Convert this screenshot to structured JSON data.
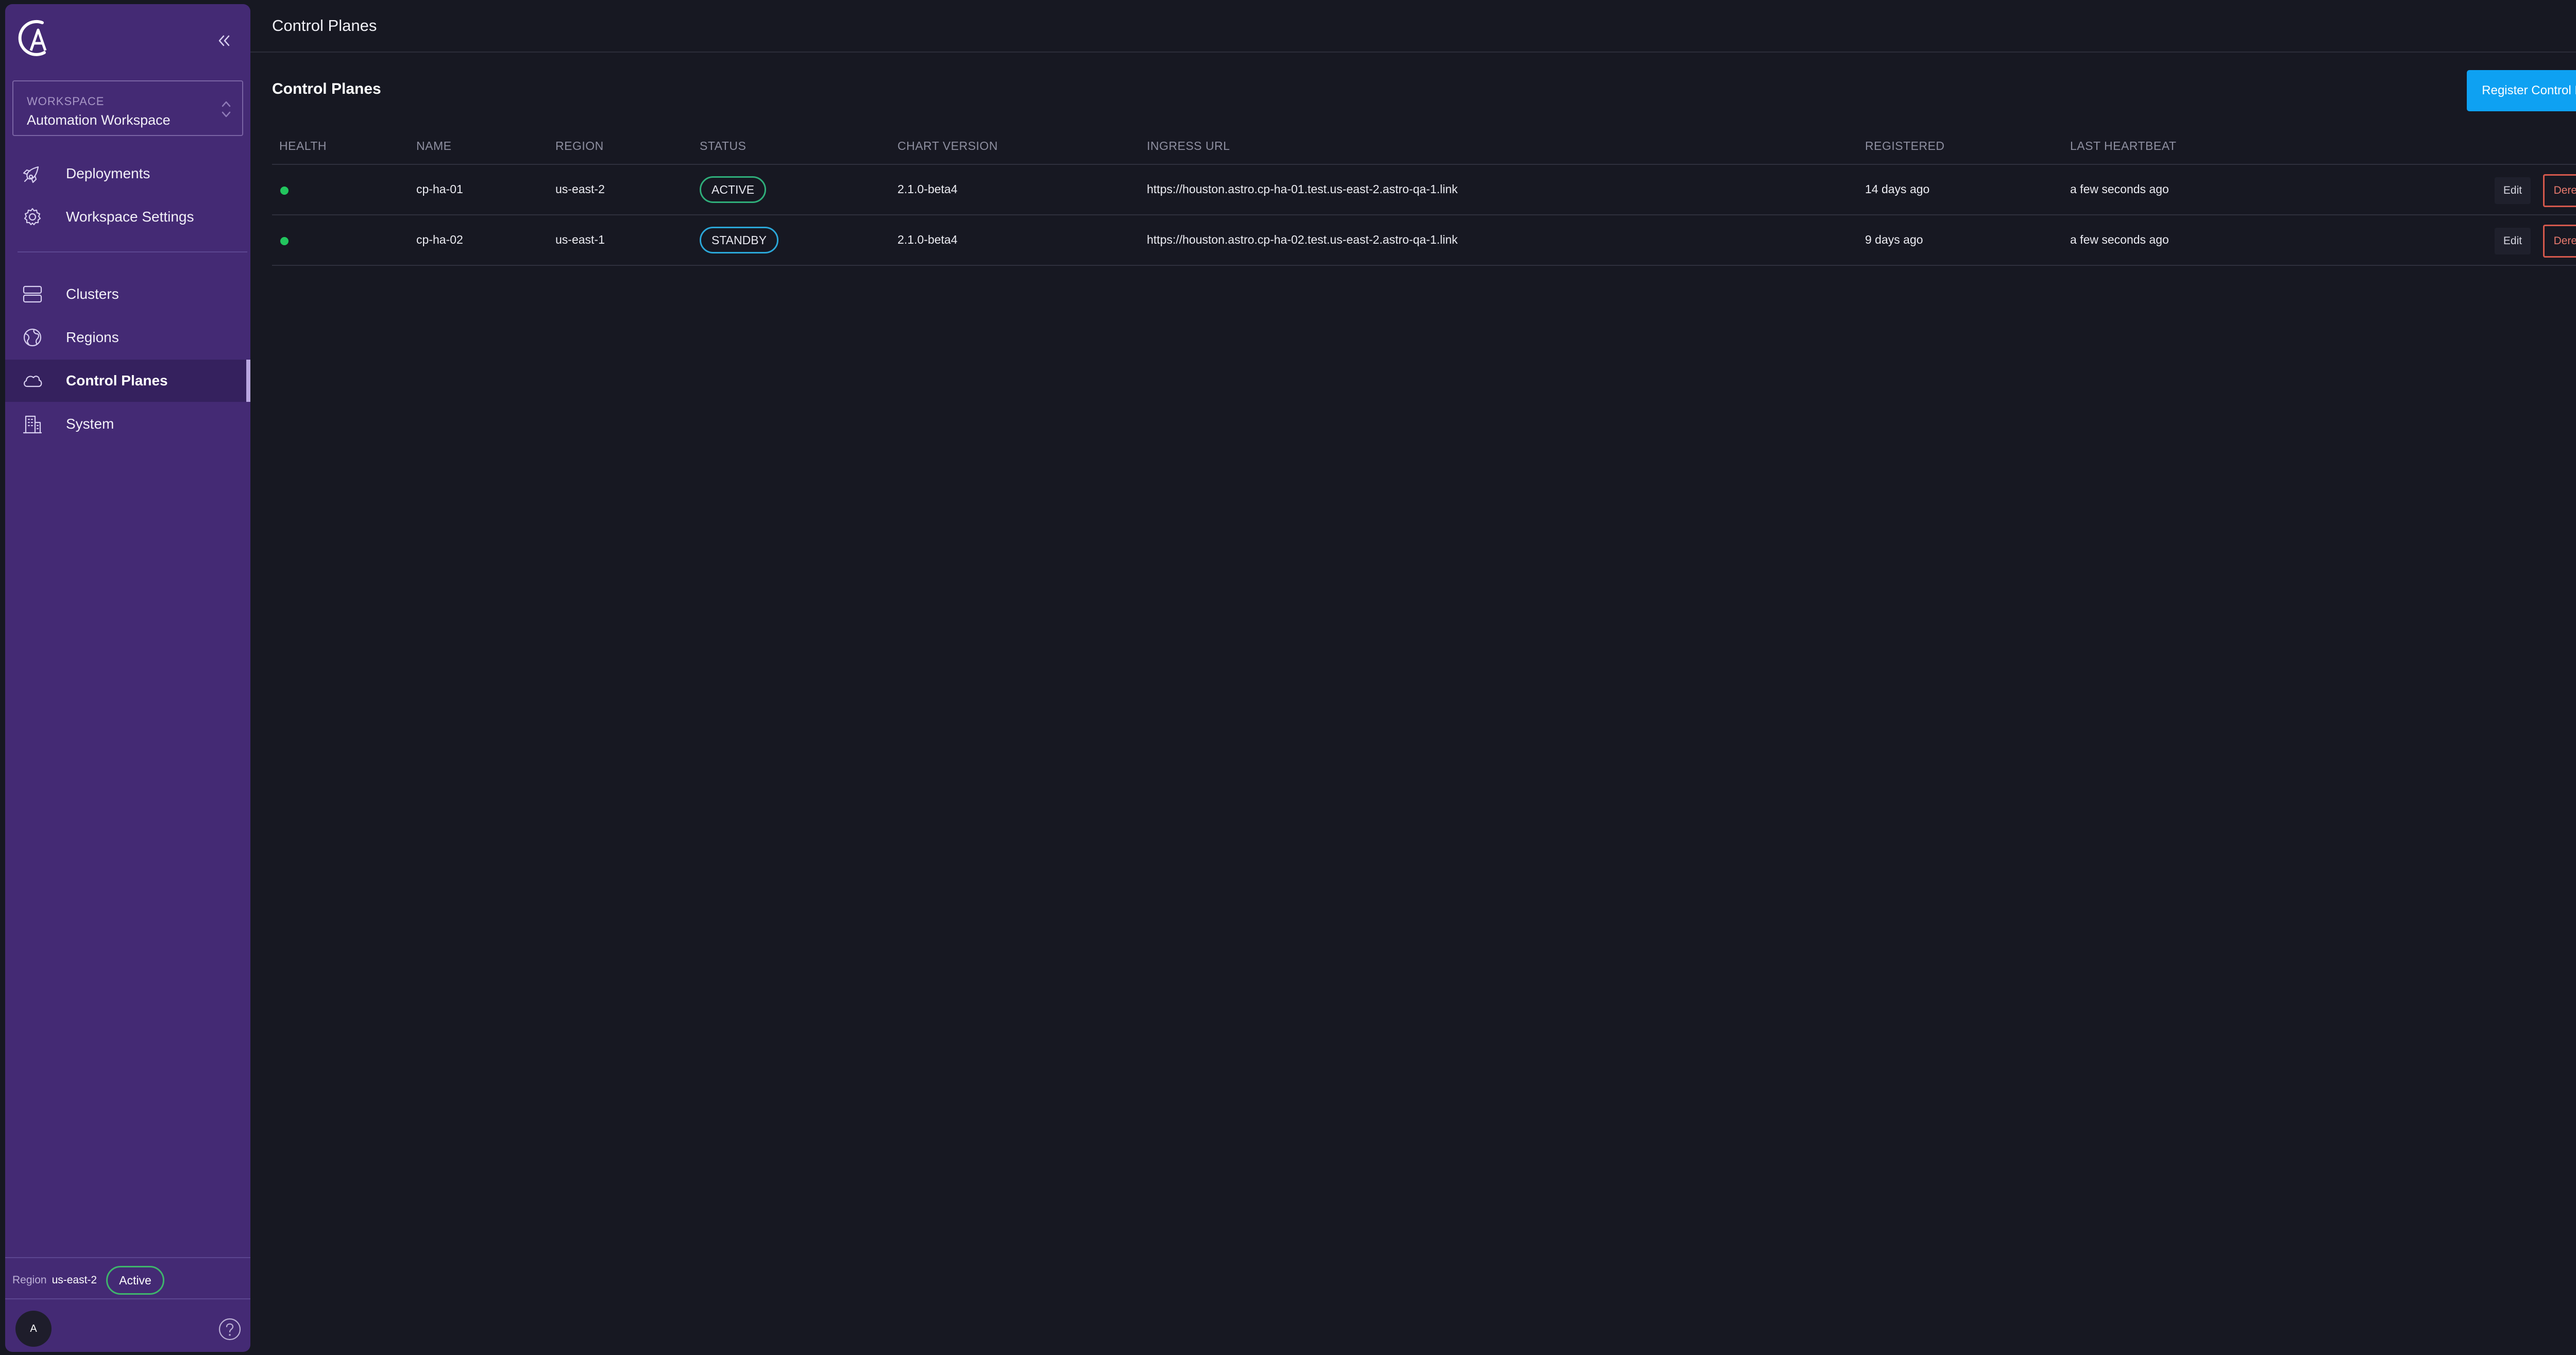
{
  "sidebar": {
    "workspace": {
      "label": "WORKSPACE",
      "name": "Automation Workspace"
    },
    "nav_top": [
      {
        "label": "Deployments",
        "icon": "rocket-icon"
      },
      {
        "label": "Workspace Settings",
        "icon": "gear-icon"
      }
    ],
    "nav_bottom": [
      {
        "label": "Clusters",
        "icon": "server-stack-icon"
      },
      {
        "label": "Regions",
        "icon": "globe-icon"
      },
      {
        "label": "Control Planes",
        "icon": "cloud-icon",
        "active": true
      },
      {
        "label": "System",
        "icon": "building-icon"
      }
    ],
    "region": {
      "label": "Region",
      "value": "us-east-2",
      "status": "Active"
    },
    "avatar_initial": "A"
  },
  "header": {
    "title": "Control Planes"
  },
  "page": {
    "title": "Control Planes",
    "register_label": "Register Control Plane"
  },
  "table": {
    "columns": [
      "HEALTH",
      "NAME",
      "REGION",
      "STATUS",
      "CHART VERSION",
      "INGRESS URL",
      "REGISTERED",
      "LAST HEARTBEAT"
    ],
    "rows": [
      {
        "health": "healthy",
        "name": "cp-ha-01",
        "region": "us-east-2",
        "status": "ACTIVE",
        "chart_version": "2.1.0-beta4",
        "ingress_url": "https://houston.astro.cp-ha-01.test.us-east-2.astro-qa-1.link",
        "registered": "14 days ago",
        "last_heartbeat": "a few seconds ago",
        "edit_label": "Edit",
        "deregister_label": "Deregister"
      },
      {
        "health": "healthy",
        "name": "cp-ha-02",
        "region": "us-east-1",
        "status": "STANDBY",
        "chart_version": "2.1.0-beta4",
        "ingress_url": "https://houston.astro.cp-ha-02.test.us-east-2.astro-qa-1.link",
        "registered": "9 days ago",
        "last_heartbeat": "a few seconds ago",
        "edit_label": "Edit",
        "deregister_label": "Deregister"
      }
    ]
  },
  "colors": {
    "sidebar_bg": "#442a74",
    "main_bg": "#171822",
    "accent_button": "#0ea1f2",
    "health_ok": "#22c55e",
    "status_active": "#2fae7a",
    "status_standby": "#2ba7d8",
    "danger": "#d4584c"
  }
}
